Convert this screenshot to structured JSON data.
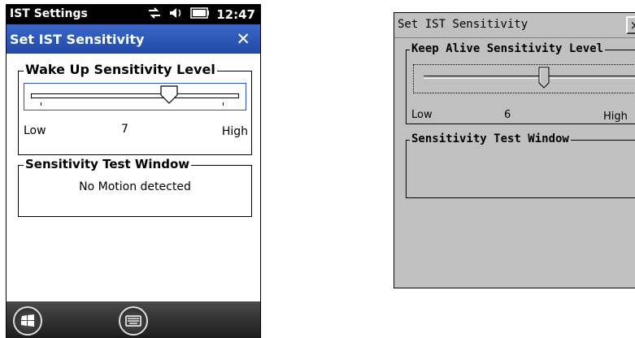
{
  "left_device": {
    "status_bar": {
      "app_name": "IST Settings",
      "time": "12:47",
      "icons": [
        "connectivity-icon",
        "volume-icon",
        "battery-icon"
      ]
    },
    "title_bar": {
      "title": "Set IST Sensitivity",
      "close_label": "✕"
    },
    "wake_group": {
      "legend": "Wake Up Sensitivity Level",
      "slider_value": 7,
      "low_label": "Low",
      "value_label": "7",
      "high_label": "High"
    },
    "test_group": {
      "legend": "Sensitivity Test Window",
      "message": "No Motion detected"
    },
    "taskbar": {
      "buttons": [
        "start-icon",
        "keyboard-icon"
      ]
    },
    "colors": {
      "title_bar": "#2a57b8",
      "status_bar": "#000000"
    }
  },
  "right_device": {
    "title_bar": {
      "title": "Set IST Sensitivity",
      "close_label": "×"
    },
    "keepalive_group": {
      "legend": "Keep Alive Sensitivity Level",
      "slider_value": 6,
      "low_label": "Low",
      "value_label": "6",
      "high_label": "High"
    },
    "test_group": {
      "legend": "Sensitivity Test Window"
    },
    "colors": {
      "background": "#c0c0c0"
    }
  }
}
